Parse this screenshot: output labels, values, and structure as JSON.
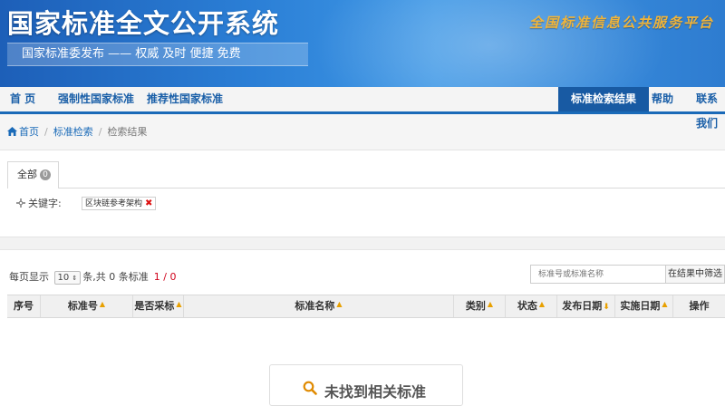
{
  "banner": {
    "title": "国家标准全文公开系统",
    "subtitle": "国家标准委发布 —— 权威 及时 便捷 免费",
    "platform": "全国标准信息公共服务平台"
  },
  "nav": {
    "home": "首 页",
    "mandatory": "强制性国家标准",
    "recommended": "推荐性国家标准",
    "results": "标准检索结果",
    "help": "帮助",
    "contact": "联系我们"
  },
  "breadcrumb": {
    "home": "首页",
    "search": "标准检索",
    "results": "检索结果"
  },
  "filter": {
    "tab_all": "全部",
    "tab_count": "0",
    "keyword_label": "关键字:",
    "keyword_value": "区块链参考架构"
  },
  "toolbar": {
    "per_page_prefix": "每页显示",
    "per_page_value": "10",
    "summary": "条,共 0 条标准",
    "page_info": "1 / 0",
    "search_placeholder": "标准号或标准名称",
    "filter_button": "在结果中筛选"
  },
  "table": {
    "columns": [
      "序号",
      "标准号",
      "是否采标",
      "标准名称",
      "类别",
      "状态",
      "发布日期",
      "实施日期",
      "操作"
    ]
  },
  "empty": {
    "message": "未找到相关标准"
  },
  "colors": {
    "brand_blue": "#185aa3",
    "accent_orange": "#e8a000",
    "alert_red": "#d0021b"
  }
}
